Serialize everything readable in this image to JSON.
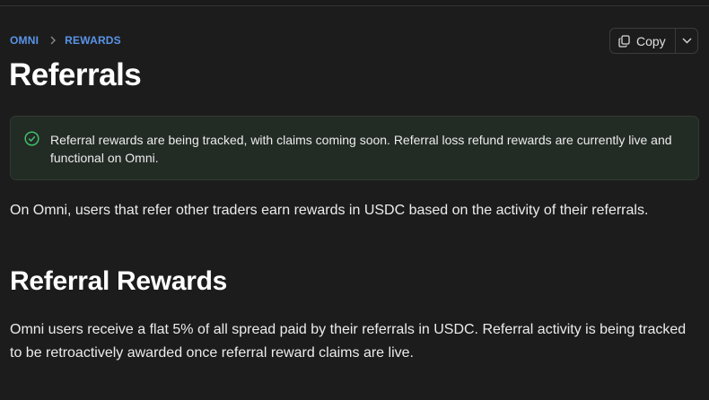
{
  "breadcrumb": {
    "items": [
      "OMNI",
      "REWARDS"
    ]
  },
  "page": {
    "title": "Referrals"
  },
  "toolbar": {
    "copy_label": "Copy"
  },
  "notice": {
    "text": "Referral rewards are being tracked, with claims coming soon. Referral loss refund rewards are currently live and functional on Omni."
  },
  "content": {
    "intro": "On Omni, users that refer other traders earn rewards in USDC based on the activity of their referrals.",
    "section_heading": "Referral Rewards",
    "section_body": "Omni users receive a flat 5% of all spread paid by their referrals in USDC. Referral activity is being tracked to be retroactively awarded once referral reward claims are live."
  },
  "colors": {
    "background": "#1c1c1c",
    "accent": "#5a94e8",
    "success": "#3fbf6a",
    "notice_bg": "#232b25"
  },
  "icons": {
    "breadcrumb_separator": "chevron-right-icon",
    "copy": "copy-icon",
    "dropdown": "chevron-down-icon",
    "notice": "check-circle-icon"
  }
}
